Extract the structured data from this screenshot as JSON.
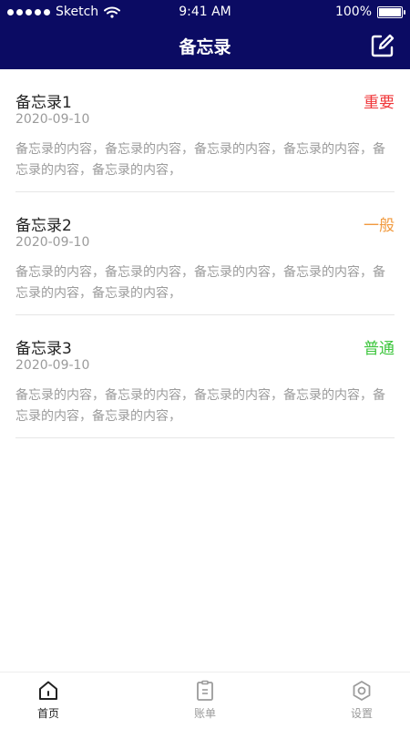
{
  "status": {
    "carrier": "Sketch",
    "time": "9:41 AM",
    "battery": "100%"
  },
  "header": {
    "title": "备忘录"
  },
  "memos": [
    {
      "name": "备忘录1",
      "date": "2020-09-10",
      "tag": "重要",
      "tag_color": "#f0373a",
      "content": "备忘录的内容，备忘录的内容，备忘录的内容，备忘录的内容，备忘录的内容，备忘录的内容，"
    },
    {
      "name": "备忘录2",
      "date": "2020-09-10",
      "tag": "一般",
      "tag_color": "#f19a3e",
      "content": "备忘录的内容，备忘录的内容，备忘录的内容，备忘录的内容，备忘录的内容，备忘录的内容，"
    },
    {
      "name": "备忘录3",
      "date": "2020-09-10",
      "tag": "普通",
      "tag_color": "#3cc53c",
      "content": "备忘录的内容，备忘录的内容，备忘录的内容，备忘录的内容，备忘录的内容，备忘录的内容，"
    }
  ],
  "tabs": [
    {
      "label": "首页",
      "icon": "home-icon",
      "active": true
    },
    {
      "label": "账单",
      "icon": "bill-icon",
      "active": false
    },
    {
      "label": "设置",
      "icon": "settings-icon",
      "active": false
    }
  ],
  "colors": {
    "header_bg": "#0b0b63",
    "tab_active": "#222222",
    "tab_inactive": "#9b9b9b"
  }
}
